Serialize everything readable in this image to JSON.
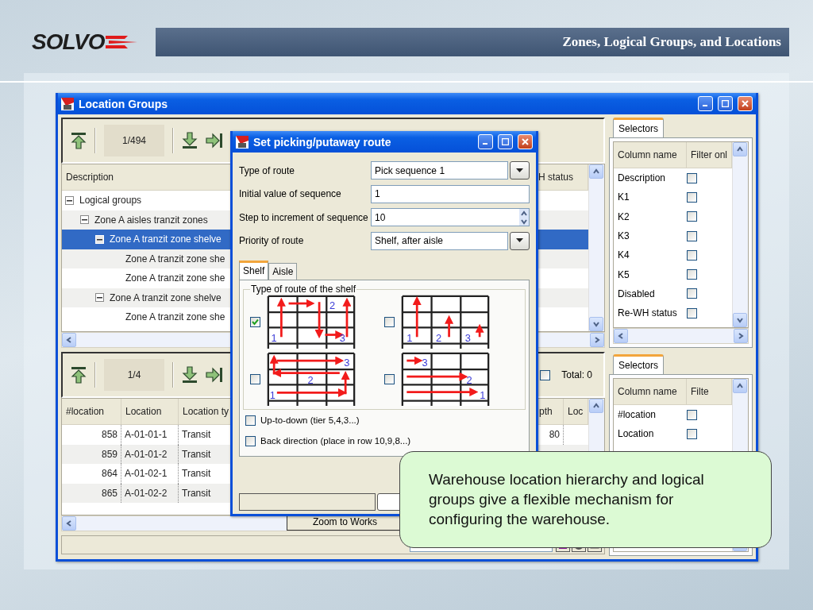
{
  "slide": {
    "logo": "SOLVO",
    "title": "Zones, Logical Groups, and Locations"
  },
  "main_window": {
    "title": "Location Groups",
    "top_pane": {
      "counter": "1/494",
      "columns": [
        "Description",
        "H status"
      ],
      "tree": [
        {
          "label": "Logical groups",
          "expanded": true,
          "selected": false,
          "children": [
            {
              "label": "Zone A aisles tranzit zones",
              "expanded": true,
              "selected": false,
              "children": [
                {
                  "label": "Zone A tranzit zone shelve",
                  "expanded": true,
                  "selected": true,
                  "children": [
                    {
                      "label": "Zone A tranzit zone she",
                      "selected": false
                    },
                    {
                      "label": "Zone A tranzit zone she",
                      "selected": false
                    }
                  ]
                },
                {
                  "label": "Zone A tranzit zone shelve",
                  "expanded": true,
                  "selected": false,
                  "children": [
                    {
                      "label": "Zone A tranzit zone she",
                      "selected": false
                    }
                  ]
                }
              ]
            }
          ]
        }
      ]
    },
    "bottom_pane": {
      "counter": "1/4",
      "total_checked": false,
      "total": "Total: 0",
      "columns": [
        "#location",
        "Location",
        "Location ty",
        "pth",
        "Loc"
      ],
      "rows": [
        {
          "cells": [
            "858",
            "A-01-01-1",
            "Transit"
          ],
          "column_4": "80"
        },
        {
          "cells": [
            "859",
            "A-01-01-2",
            "Transit"
          ]
        },
        {
          "cells": [
            "864",
            "A-01-02-1",
            "Transit"
          ]
        },
        {
          "cells": [
            "865",
            "A-01-02-2",
            "Transit"
          ]
        }
      ]
    },
    "zoom_button": "Zoom to Works",
    "selectors": [
      {
        "tab": "Selectors",
        "columns": [
          "Column name",
          "Filter onl"
        ],
        "rows": [
          {
            "name": "Description",
            "checked": false
          },
          {
            "name": "K1",
            "checked": false
          },
          {
            "name": "K2",
            "checked": false
          },
          {
            "name": "K3",
            "checked": false
          },
          {
            "name": "K4",
            "checked": false
          },
          {
            "name": "K5",
            "checked": false
          },
          {
            "name": "Disabled",
            "checked": false
          },
          {
            "name": "Re-WH status",
            "checked": false
          }
        ]
      },
      {
        "tab": "Selectors",
        "columns": [
          "Column name",
          "Filte"
        ],
        "rows": [
          {
            "name": "#location",
            "checked": false
          },
          {
            "name": "Location",
            "checked": false
          }
        ]
      }
    ]
  },
  "dialog": {
    "title": "Set picking/putaway route",
    "fields": [
      {
        "kind": "dropdown",
        "label": "Type of route",
        "value": "Pick sequence 1"
      },
      {
        "kind": "text",
        "label": "Initial value of sequence",
        "value": "1"
      },
      {
        "kind": "spinner",
        "label": "Step to increment of sequence",
        "value": "10"
      },
      {
        "kind": "dropdown",
        "label": "Priority of route",
        "value": "Shelf, after aisle"
      }
    ],
    "tabs": [
      {
        "label": "Shelf",
        "selected": true
      },
      {
        "label": "Aisle",
        "selected": false
      }
    ],
    "group_title": "Type of route of the shelf",
    "route_options": [
      {
        "kind": "snake-columns",
        "checked": true,
        "markers": [
          "1",
          "2",
          "3"
        ]
      },
      {
        "kind": "columns-up",
        "checked": false,
        "markers": [
          "1",
          "2",
          "3"
        ]
      },
      {
        "kind": "snake-rows",
        "checked": false,
        "markers": [
          "1",
          "2",
          "3"
        ]
      },
      {
        "kind": "rows-right",
        "checked": false,
        "markers": [
          "1",
          "2",
          "3"
        ]
      }
    ],
    "options": [
      {
        "label": "Up-to-down (tier 5,4,3...)",
        "checked": false
      },
      {
        "label": "Back direction (place in row 10,9,8...)",
        "checked": false
      }
    ]
  },
  "callout": "Warehouse location hierarchy and logical groups give a flexible mechanism for configuring the warehouse."
}
